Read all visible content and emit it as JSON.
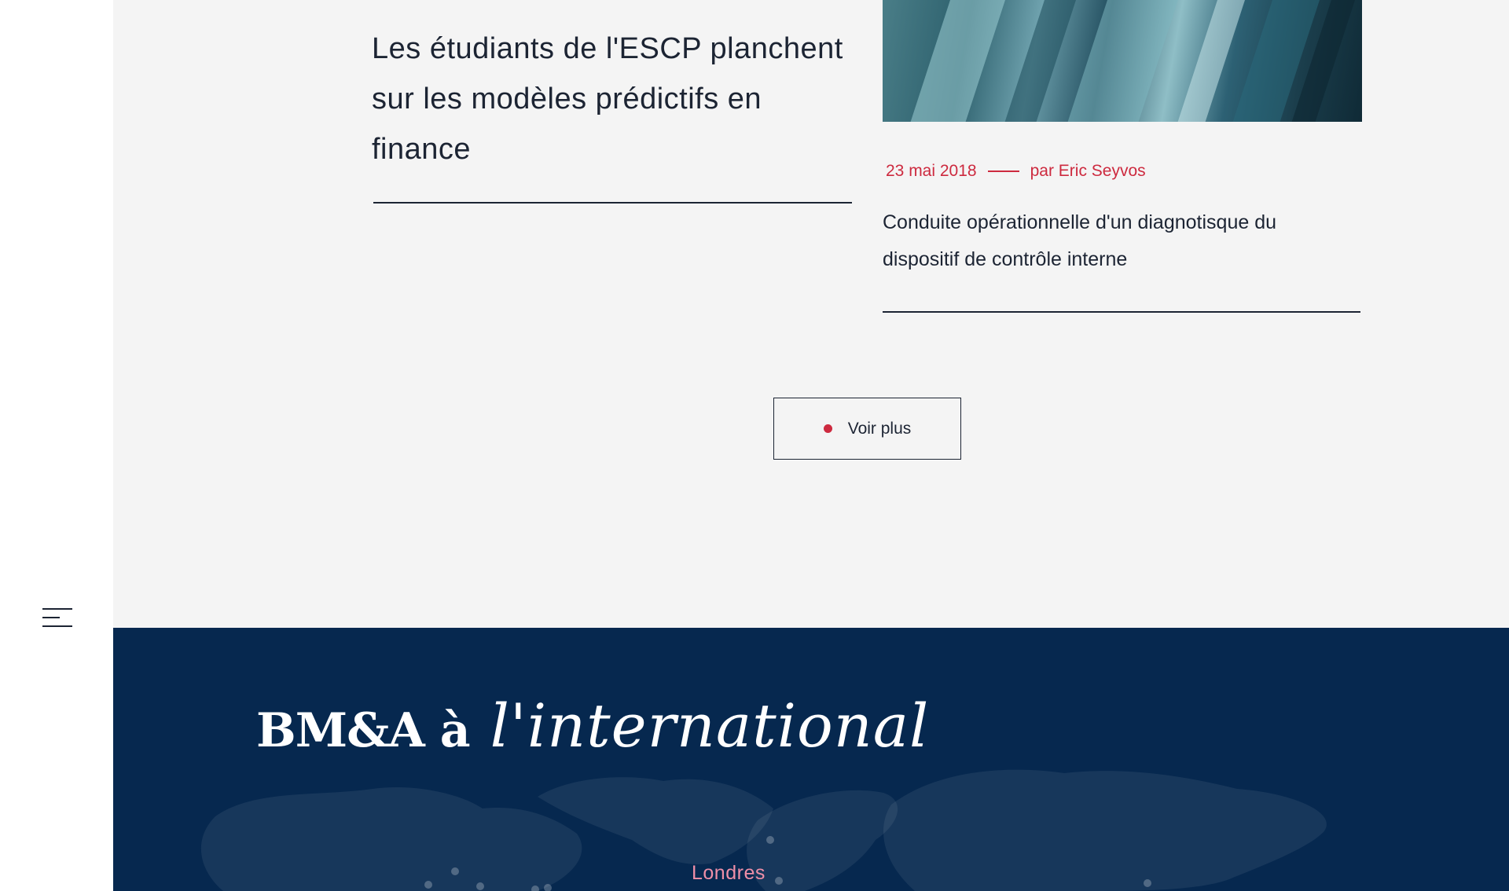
{
  "navigation": {
    "menu_icon": "hamburger-menu-icon"
  },
  "articles": {
    "left": {
      "title": "Les étudiants de l'ESCP planchent sur les modèles prédictifs en finance"
    },
    "right": {
      "image_alt": "aerial-river-delta-image",
      "date": "23 mai 2018",
      "author": "par Eric Seyvos",
      "excerpt": "Conduite opérationnelle d'un diagnotisque du dispositif de contrôle interne"
    }
  },
  "load_more": {
    "label": "Voir plus"
  },
  "international": {
    "title_strong": "BM&A à",
    "title_script": "l'international",
    "map_icon": "world-map-icon",
    "cities": [
      {
        "name": "Londres"
      }
    ]
  },
  "colors": {
    "accent": "#cd2a3f",
    "navy": "#06284f",
    "light_bg": "#f4f4f4",
    "text": "#1c2433",
    "city_label": "#ef8fa8"
  }
}
